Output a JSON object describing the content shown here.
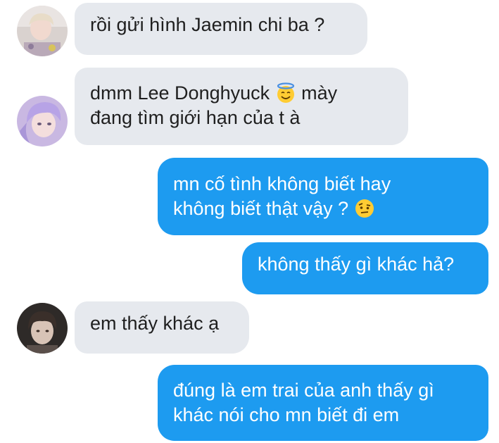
{
  "messages": [
    {
      "sender": "incoming",
      "avatar": "avatar-blond-boy",
      "text": "rồi gửi hình Jaemin chi ba ?"
    },
    {
      "sender": "incoming",
      "avatar": "avatar-purple-hair",
      "line1_before": "dmm Lee Donghyuck ",
      "line1_emoji": "halo-smile-emoji",
      "line1_after": " mày",
      "line2": "đang tìm giới hạn của t à"
    },
    {
      "sender": "outgoing",
      "line1": "mn cố tình không biết hay",
      "line2_before": "không biết thật vậy ? ",
      "line2_emoji": "raised-eyebrow-emoji"
    },
    {
      "sender": "outgoing",
      "text": "không thấy gì khác hả?"
    },
    {
      "sender": "incoming",
      "avatar": "avatar-dark-hair",
      "text": "em thấy khác ạ"
    },
    {
      "sender": "outgoing",
      "line1": "đúng là em trai của anh thấy gì",
      "line2": "khác nói cho mn biết đi em"
    }
  ],
  "colors": {
    "incoming_bubble": "#e6e9ee",
    "outgoing_bubble": "#1d9bf0",
    "incoming_text": "#1f1f1f",
    "outgoing_text": "#ffffff"
  }
}
